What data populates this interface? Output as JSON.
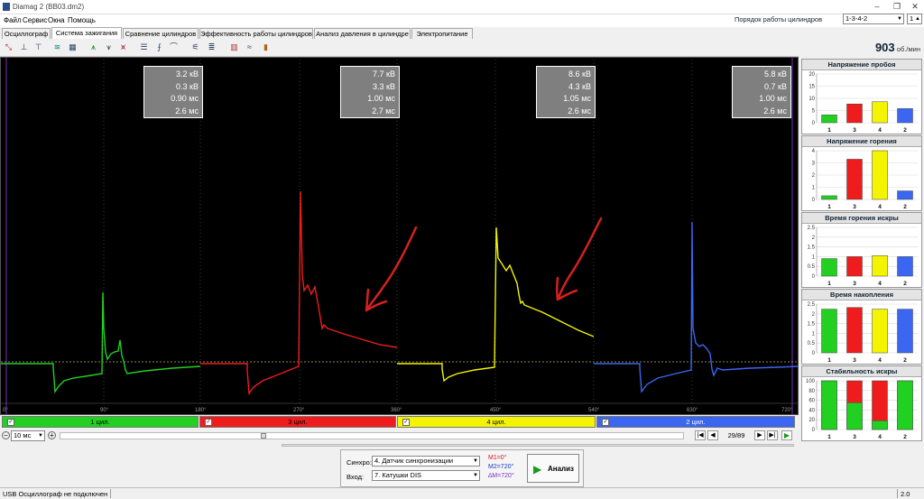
{
  "window": {
    "title": "Diamag 2 (BB03.dm2)"
  },
  "menu": [
    "Файл",
    "Сервис",
    "Окна",
    "Помощь"
  ],
  "tabs": [
    {
      "label": "Осциллограф"
    },
    {
      "label": "Система зажигания"
    },
    {
      "label": "Сравнение цилиндров"
    },
    {
      "label": "Эффективность работы цилиндров"
    },
    {
      "label": "Анализ давления в цилиндре"
    },
    {
      "label": "Электропитание"
    }
  ],
  "firing_order": {
    "label": "Порядок работы цилиндров",
    "value": "1-3-4-2",
    "count": "1"
  },
  "rpm": {
    "value": "903",
    "unit": "об./мин"
  },
  "info_boxes": [
    {
      "lines": [
        "3.2 кВ",
        "0.3 кВ",
        "0.90 мс",
        "2.6 мс"
      ],
      "border": "#39d439"
    },
    {
      "lines": [
        "7.7 кВ",
        "3.3 кВ",
        "1.00 мс",
        "2.7 мс"
      ],
      "border": "#e82020"
    },
    {
      "lines": [
        "8.6 кВ",
        "4.3 кВ",
        "1.05 мс",
        "2.6 мс"
      ],
      "border": "#e8e800"
    },
    {
      "lines": [
        "5.8 кВ",
        "0.7 кВ",
        "1.00 мс",
        "2.6 мс"
      ],
      "border": "#3060f0"
    }
  ],
  "x_axis_labels": [
    "0°",
    "90°",
    "180°",
    "270°",
    "360°",
    "450°",
    "540°",
    "630°",
    "720°"
  ],
  "cylinders": [
    {
      "label": "1 цил.",
      "color": "#22d022"
    },
    {
      "label": "3 цил.",
      "color": "#ee1c1c"
    },
    {
      "label": "4 цил.",
      "color": "#f4f400"
    },
    {
      "label": "2 цил.",
      "color": "#3a66f2"
    }
  ],
  "time_scale": {
    "value": "10 мс"
  },
  "navigation": {
    "position": "29/89"
  },
  "sync": {
    "label": "Синхро:",
    "value": "4. Датчик синхронизации"
  },
  "input": {
    "label": "Вход:",
    "value": "7. Катушки DIS"
  },
  "markers": {
    "m1": "M1=0°",
    "m2": "M2=720°",
    "dm": "∆M=720°"
  },
  "analyze_button": "Анализ",
  "status": {
    "left": "USB Осциллограф не подключен",
    "right": "2.0"
  },
  "side_charts": [
    {
      "title": "Напряжение пробоя",
      "yticks": [
        "20",
        "15",
        "10",
        "5",
        "0"
      ],
      "ymax": 20,
      "categories": [
        "1",
        "3",
        "4",
        "2"
      ],
      "values": [
        3.2,
        7.7,
        8.6,
        5.8
      ]
    },
    {
      "title": "Напряжение горения",
      "yticks": [
        "4",
        "3",
        "2",
        "1",
        "0"
      ],
      "ymax": 4,
      "categories": [
        "1",
        "3",
        "4",
        "2"
      ],
      "values": [
        0.3,
        3.3,
        4.3,
        0.7
      ]
    },
    {
      "title": "Время горения искры",
      "yticks": [
        "2.5",
        "2",
        "1.5",
        "1",
        "0.5",
        "0"
      ],
      "ymax": 2.5,
      "categories": [
        "1",
        "3",
        "4",
        "2"
      ],
      "values": [
        0.9,
        1.0,
        1.05,
        1.0
      ]
    },
    {
      "title": "Время накопления",
      "yticks": [
        "2.5",
        "2",
        "1.5",
        "1",
        "0.5",
        "0"
      ],
      "ymax": 2.9,
      "categories": [
        "1",
        "3",
        "4",
        "2"
      ],
      "values": [
        2.6,
        2.7,
        2.6,
        2.6
      ]
    },
    {
      "title": "Стабильность искры",
      "yticks": [
        "100",
        "80",
        "60",
        "40",
        "20",
        "0"
      ],
      "ymax": 100,
      "categories": [
        "1",
        "3",
        "4",
        "2"
      ],
      "values": [
        100,
        55,
        18,
        100
      ]
    }
  ],
  "colors": {
    "green": "#22d022",
    "red": "#ee1c1c",
    "yellow": "#f4f400",
    "blue": "#3a66f2",
    "annotation": "#d42020"
  }
}
